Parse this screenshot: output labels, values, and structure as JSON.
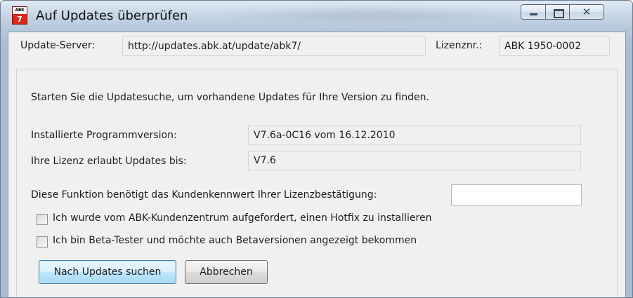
{
  "window": {
    "title": "Auf Updates überprüfen",
    "icon_top_text": "ABK",
    "icon_number": "7",
    "close_glyph": "✕"
  },
  "server": {
    "label": "Update-Server:",
    "value": "http://updates.abk.at/update/abk7/",
    "license_label": "Lizenznr.:",
    "license_value": "ABK 1950-0002"
  },
  "main": {
    "intro": "Starten Sie die Updatesuche, um vorhandene Updates für Ihre Version zu finden.",
    "installed_label": "Installierte Programmversion:",
    "installed_value": "V7.6a-0C16 vom 16.12.2010",
    "license_until_label": "Ihre Lizenz erlaubt Updates bis:",
    "license_until_value": "V7.6",
    "kennwert_label": "Diese Funktion benötigt das Kundenkennwert Ihrer Lizenzbestätigung:",
    "kennwert_value": "",
    "checkbox_hotfix": "Ich wurde vom ABK-Kundenzentrum aufgefordert, einen Hotfix zu installieren",
    "checkbox_beta": "Ich bin Beta-Tester und möchte auch Betaversionen angezeigt bekommen"
  },
  "buttons": {
    "search": "Nach Updates suchen",
    "cancel": "Abbrechen"
  },
  "colors": {
    "app_icon_red": "#d8291f",
    "default_button_border": "#3c7fb1"
  }
}
